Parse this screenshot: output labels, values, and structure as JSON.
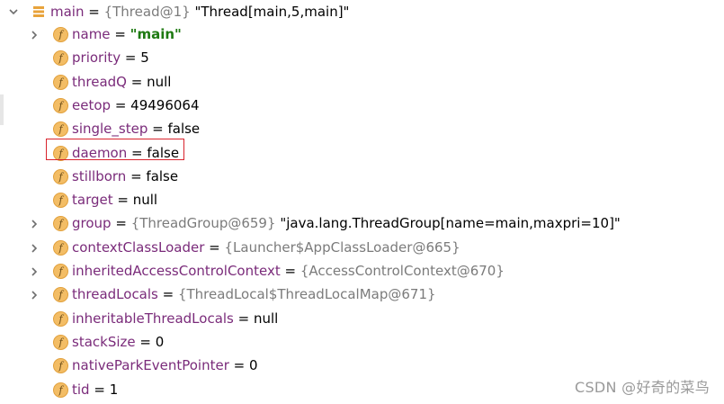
{
  "root": {
    "name": "main",
    "equals": " = ",
    "ref": "{Thread@1}",
    "value": "\"Thread[main,5,main]\""
  },
  "fields": [
    {
      "name": "name",
      "equals": " = ",
      "value": "\"main\"",
      "value_kind": "string",
      "expandable": true
    },
    {
      "name": "priority",
      "equals": " = ",
      "value": "5",
      "value_kind": "plain",
      "expandable": false
    },
    {
      "name": "threadQ",
      "equals": " = ",
      "value": "null",
      "value_kind": "plain",
      "expandable": false
    },
    {
      "name": "eetop",
      "equals": " = ",
      "value": "49496064",
      "value_kind": "plain",
      "expandable": false
    },
    {
      "name": "single_step",
      "equals": " = ",
      "value": "false",
      "value_kind": "plain",
      "expandable": false
    },
    {
      "name": "daemon",
      "equals": " = ",
      "value": "false",
      "value_kind": "plain",
      "expandable": false,
      "highlighted": true
    },
    {
      "name": "stillborn",
      "equals": " = ",
      "value": "false",
      "value_kind": "plain",
      "expandable": false
    },
    {
      "name": "target",
      "equals": " = ",
      "value": "null",
      "value_kind": "plain",
      "expandable": false
    },
    {
      "name": "group",
      "equals": " = ",
      "ref": "{ThreadGroup@659}",
      "value": "\"java.lang.ThreadGroup[name=main,maxpri=10]\"",
      "value_kind": "ref+plain",
      "expandable": true
    },
    {
      "name": "contextClassLoader",
      "equals": " = ",
      "ref": "{Launcher$AppClassLoader@665}",
      "value_kind": "ref",
      "expandable": true
    },
    {
      "name": "inheritedAccessControlContext",
      "equals": " = ",
      "ref": "{AccessControlContext@670}",
      "value_kind": "ref",
      "expandable": true
    },
    {
      "name": "threadLocals",
      "equals": " = ",
      "ref": "{ThreadLocal$ThreadLocalMap@671}",
      "value_kind": "ref",
      "expandable": true
    },
    {
      "name": "inheritableThreadLocals",
      "equals": " = ",
      "value": "null",
      "value_kind": "plain",
      "expandable": false
    },
    {
      "name": "stackSize",
      "equals": " = ",
      "value": "0",
      "value_kind": "plain",
      "expandable": false
    },
    {
      "name": "nativeParkEventPointer",
      "equals": " = ",
      "value": "0",
      "value_kind": "plain",
      "expandable": false
    },
    {
      "name": "tid",
      "equals": " = ",
      "value": "1",
      "value_kind": "plain",
      "expandable": false
    }
  ],
  "field_badge_letter": "f",
  "watermark": "CSDN @好奇的菜鸟",
  "colors": {
    "field_name": "#7a2b7a",
    "ref": "#7b7b7b",
    "string": "#1e7a12",
    "badge": "#f3bd65",
    "highlight": "#d9232d"
  }
}
